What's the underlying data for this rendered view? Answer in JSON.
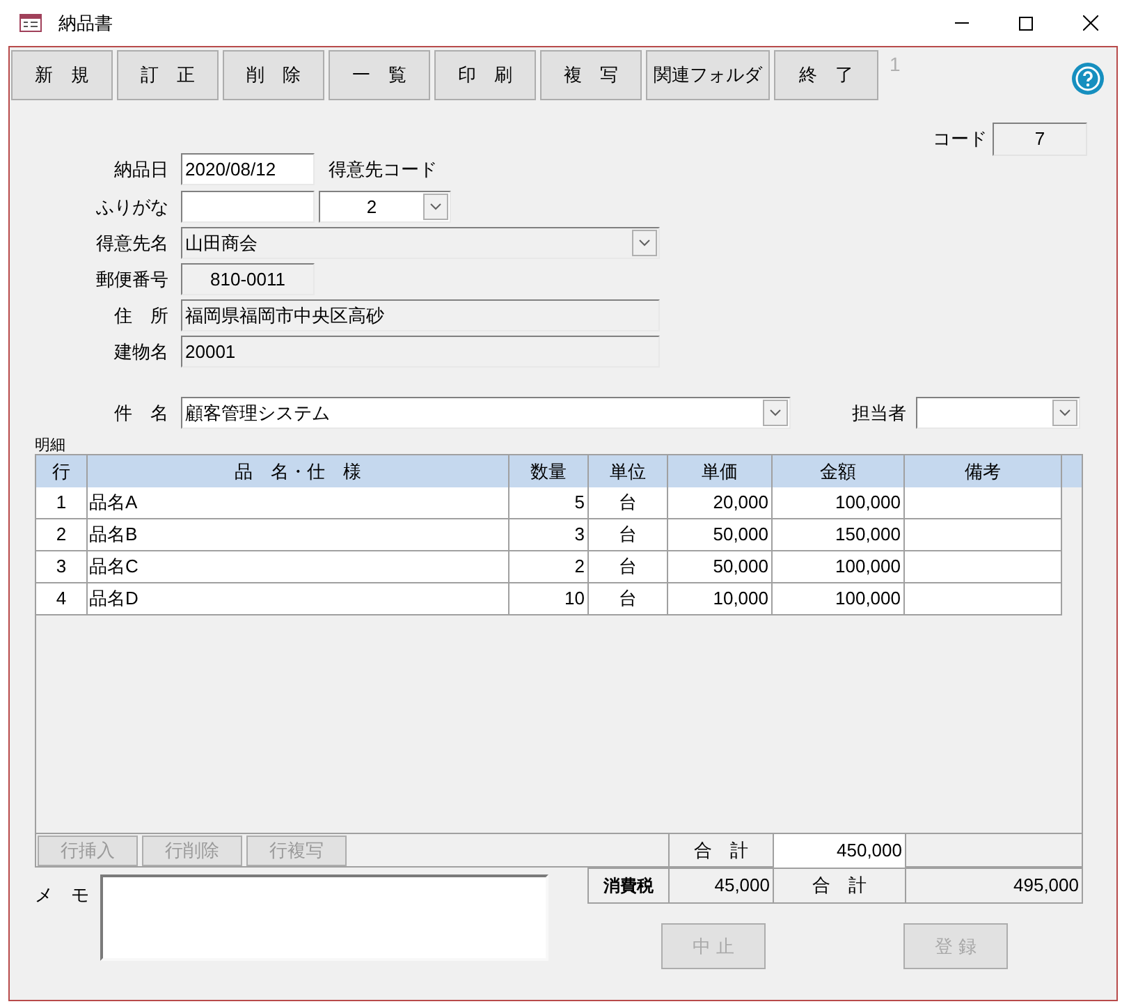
{
  "window": {
    "title": "納品書"
  },
  "toolbar": [
    {
      "label": "新　規"
    },
    {
      "label": "訂　正"
    },
    {
      "label": "削　除"
    },
    {
      "label": "一　覧"
    },
    {
      "label": "印　刷"
    },
    {
      "label": "複　写"
    },
    {
      "label": "関連フォルダ"
    },
    {
      "label": "終　了"
    }
  ],
  "record_number": "1",
  "code": {
    "label": "コード",
    "value": "7"
  },
  "delivery_date": {
    "label": "納品日",
    "value": "2020/08/12"
  },
  "customer_code": {
    "label": "得意先コード",
    "value": "2"
  },
  "furigana": {
    "label": "ふりがな"
  },
  "customer_name": {
    "label": "得意先名",
    "value": "山田商会"
  },
  "postal_code": {
    "label": "郵便番号",
    "value": "810-0011"
  },
  "address": {
    "label": "住　所",
    "value": "福岡県福岡市中央区高砂"
  },
  "building": {
    "label": "建物名",
    "value": "20001"
  },
  "subject": {
    "label": "件　名",
    "value": "顧客管理システム"
  },
  "person_in_charge": {
    "label": "担当者"
  },
  "details": {
    "label": "明細",
    "columns": [
      "行",
      "品　名・仕　様",
      "数量",
      "単位",
      "単価",
      "金額",
      "備考"
    ],
    "rows": [
      [
        "1",
        "品名A",
        "5",
        "台",
        "20,000",
        "100,000"
      ],
      [
        "2",
        "品名B",
        "3",
        "台",
        "50,000",
        "150,000"
      ],
      [
        "3",
        "品名C",
        "2",
        "台",
        "50,000",
        "100,000"
      ],
      [
        "4",
        "品名D",
        "10",
        "台",
        "10,000",
        "100,000"
      ]
    ]
  },
  "row_buttons": [
    {
      "label": "行挿入",
      "disabled": true
    },
    {
      "label": "行削除",
      "disabled": true
    },
    {
      "label": "行複写",
      "disabled": true
    }
  ],
  "subtotal": {
    "label": "合　計",
    "value": "450,000"
  },
  "tax": {
    "label": "消費税",
    "value": "45,000"
  },
  "total": {
    "label": "合　計",
    "value": "495,000"
  },
  "memo": {
    "label": "メ　モ"
  },
  "action_buttons": [
    {
      "label": "中 止",
      "disabled": true
    },
    {
      "label": "登 録",
      "disabled": true
    }
  ]
}
